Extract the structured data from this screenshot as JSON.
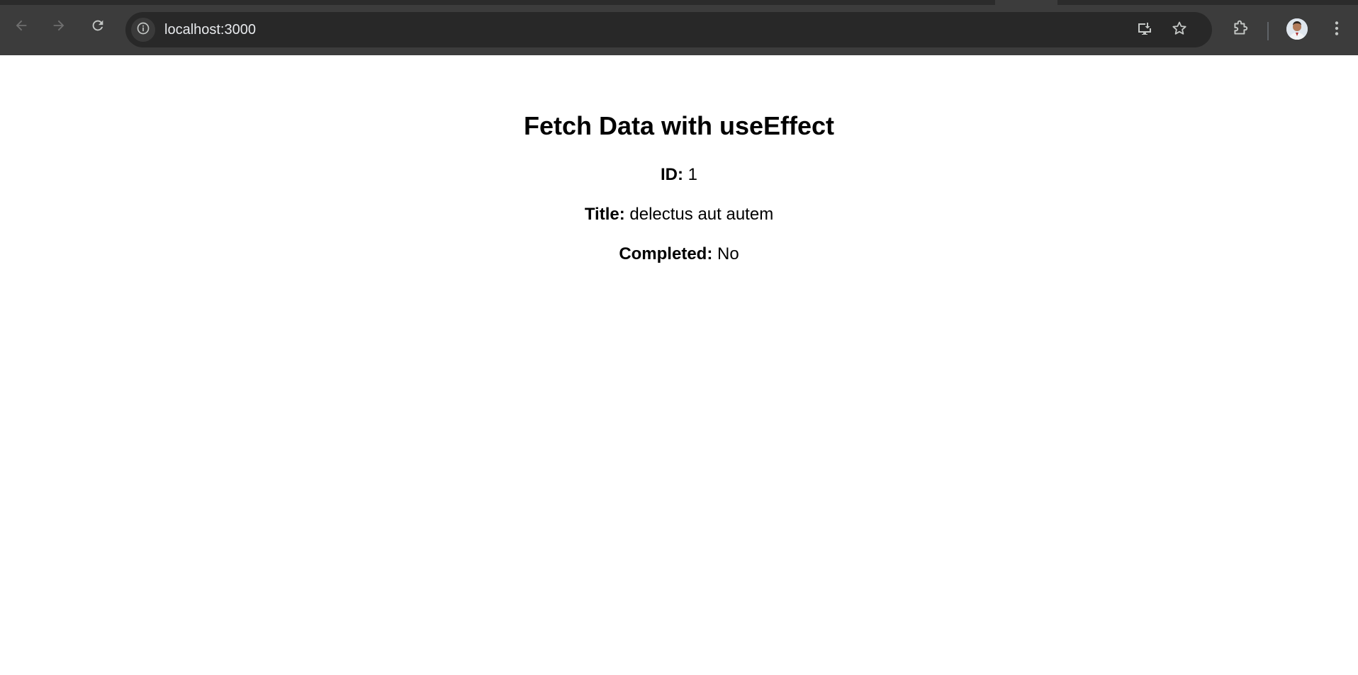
{
  "browser": {
    "url": "localhost:3000",
    "icons": {
      "back": "arrow-left-icon",
      "forward": "arrow-right-icon",
      "reload": "reload-icon",
      "site_info": "info-icon",
      "install": "install-app-icon",
      "bookmark": "star-icon",
      "extensions": "puzzle-icon",
      "profile": "avatar",
      "menu": "kebab-menu-icon"
    },
    "colors": {
      "frame": "#3c3c3c",
      "omnibox": "#282828",
      "icon": "#c4c7c5"
    }
  },
  "page": {
    "title": "Fetch Data with useEffect",
    "fields": [
      {
        "label": "ID:",
        "value": "1"
      },
      {
        "label": "Title:",
        "value": "delectus aut autem"
      },
      {
        "label": "Completed:",
        "value": "No"
      }
    ]
  }
}
